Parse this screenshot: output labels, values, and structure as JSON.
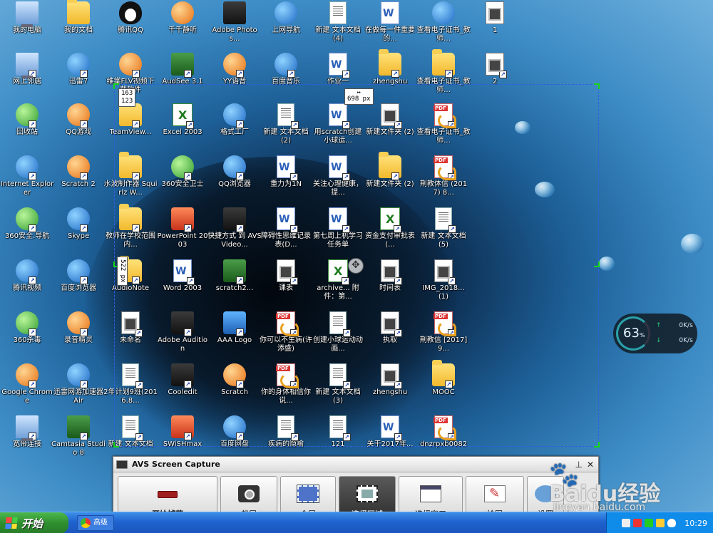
{
  "desktop_icons": [
    {
      "label": "我的电脑",
      "type": "computer"
    },
    {
      "label": "我的文档",
      "type": "folder"
    },
    {
      "label": "腾讯QQ",
      "type": "penguin"
    },
    {
      "label": "千千静听",
      "type": "round-orange"
    },
    {
      "label": "Adobe Photos...",
      "type": "square-dark"
    },
    {
      "label": "上网导航",
      "type": "round-blue"
    },
    {
      "label": "新建 文本文档 (4)",
      "type": "doc"
    },
    {
      "label": "在做每一件重要的...",
      "type": "word"
    },
    {
      "label": "查看电子证书_教师...",
      "type": "round-blue"
    },
    {
      "label": "1",
      "type": "img"
    },
    {
      "label": "网上邻居",
      "type": "computer"
    },
    {
      "label": "迅雷7",
      "type": "round-blue"
    },
    {
      "label": "维棠FLV视频下载软件",
      "type": "round-orange"
    },
    {
      "label": "AudSee 3.1",
      "type": "square-green"
    },
    {
      "label": "YY语音",
      "type": "round-orange"
    },
    {
      "label": "百度音乐",
      "type": "round-blue"
    },
    {
      "label": "作业一",
      "type": "word"
    },
    {
      "label": "zhengshu",
      "type": "folder"
    },
    {
      "label": "查看电子证书_教师...",
      "type": "folder"
    },
    {
      "label": "2",
      "type": "img"
    },
    {
      "label": "回收站",
      "type": "round-green"
    },
    {
      "label": "QQ游戏",
      "type": "round-orange"
    },
    {
      "label": "TeamView...",
      "type": "folder"
    },
    {
      "label": "Excel 2003",
      "type": "excel"
    },
    {
      "label": "格式工厂",
      "type": "round-blue"
    },
    {
      "label": "新建 文本文档 (2)",
      "type": "doc"
    },
    {
      "label": "用scratch创建小球运...",
      "type": "word"
    },
    {
      "label": "新建文件夹 (2)",
      "type": "img"
    },
    {
      "label": "查看电子证书_教师...",
      "type": "pdf"
    },
    {
      "label": "Internet Explorer",
      "type": "round-blue"
    },
    {
      "label": "Scratch 2",
      "type": "round-orange"
    },
    {
      "label": "水波制作器 Squirlz W...",
      "type": "folder"
    },
    {
      "label": "360安全卫士",
      "type": "round-green"
    },
    {
      "label": "QQ浏览器",
      "type": "round-blue"
    },
    {
      "label": "重力为1N",
      "type": "word"
    },
    {
      "label": "关注心理健康，提...",
      "type": "word"
    },
    {
      "label": "新建文件夹 (2)",
      "type": "folder"
    },
    {
      "label": "荆教体信 (2017) 8...",
      "type": "pdf"
    },
    {
      "label": "360安全.导航",
      "type": "round-green"
    },
    {
      "label": "Skype",
      "type": "round-blue"
    },
    {
      "label": "教师在学校范围内...",
      "type": "folder"
    },
    {
      "label": "PowerPoint 2003",
      "type": "square-red"
    },
    {
      "label": "快捷方式 到 AVSVideo...",
      "type": "square-dark"
    },
    {
      "label": "障碍性思维记录表(D...",
      "type": "word"
    },
    {
      "label": "第七周上机学习任务单",
      "type": "word"
    },
    {
      "label": "资金支付审批表(...",
      "type": "excel"
    },
    {
      "label": "新建 文本文档 (5)",
      "type": "doc"
    },
    {
      "label": "腾讯视频",
      "type": "round-blue"
    },
    {
      "label": "百度浏览器",
      "type": "round-blue"
    },
    {
      "label": "AudioNote",
      "type": "folder"
    },
    {
      "label": "Word 2003",
      "type": "word"
    },
    {
      "label": "scratch2...",
      "type": "square-green"
    },
    {
      "label": "课表",
      "type": "img"
    },
    {
      "label": "archive... 附件：第...",
      "type": "excel"
    },
    {
      "label": "时间表",
      "type": "img"
    },
    {
      "label": "IMG_2018... (1)",
      "type": "img"
    },
    {
      "label": "360杀毒",
      "type": "round-green"
    },
    {
      "label": "录音精灵",
      "type": "round-orange"
    },
    {
      "label": "未命名",
      "type": "img"
    },
    {
      "label": "Adobe Audition",
      "type": "square-dark"
    },
    {
      "label": "AAA Logo",
      "type": "square-blue"
    },
    {
      "label": "你可以不生病(许添盛)",
      "type": "pdf"
    },
    {
      "label": "创建小球运动动画...",
      "type": "doc"
    },
    {
      "label": "执取",
      "type": "img"
    },
    {
      "label": "荆教信 [2017]9...",
      "type": "pdf"
    },
    {
      "label": "Google Chrome",
      "type": "round-orange"
    },
    {
      "label": "迅雷网游加速器Air",
      "type": "round-blue"
    },
    {
      "label": "2年计划9班(2016.8...",
      "type": "doc"
    },
    {
      "label": "Cooledit",
      "type": "square-dark"
    },
    {
      "label": "Scratch",
      "type": "round-orange"
    },
    {
      "label": "你的身体相信你说...",
      "type": "pdf"
    },
    {
      "label": "新建 文本文档 (3)",
      "type": "doc"
    },
    {
      "label": "zhengshu",
      "type": "img"
    },
    {
      "label": "MOOC",
      "type": "folder"
    },
    {
      "label": "宽带连接",
      "type": "computer"
    },
    {
      "label": "Camtasia Studio 8",
      "type": "square-green"
    },
    {
      "label": "新建 文本文档",
      "type": "doc"
    },
    {
      "label": "SWiSHmax",
      "type": "square-red"
    },
    {
      "label": "百度网盘",
      "type": "round-blue"
    },
    {
      "label": "疾病的隐喻",
      "type": "doc"
    },
    {
      "label": "121",
      "type": "doc"
    },
    {
      "label": "关于2017年...",
      "type": "word"
    },
    {
      "label": "dnzrpxb0082",
      "type": "pdf"
    }
  ],
  "selection": {
    "origin_readout": [
      "163",
      "123"
    ],
    "width_readout": "698 px",
    "height_readout": "522 px"
  },
  "widget": {
    "cpu_percent": "63",
    "percent_sign": "%",
    "upload": "0K/s",
    "download": "0K/s"
  },
  "avs": {
    "title": "AVS Screen Capture",
    "pin": "⊥",
    "close": "✕",
    "buttons": [
      {
        "label": "开始捕获",
        "icon": "rec",
        "active": false
      },
      {
        "label": "截屏",
        "icon": "cam",
        "active": false
      },
      {
        "label": "全屏",
        "icon": "full",
        "active": false
      },
      {
        "label": "选择区域",
        "icon": "region",
        "active": true
      },
      {
        "label": "选择窗口",
        "icon": "window",
        "active": false
      },
      {
        "label": "绘图",
        "icon": "draw",
        "active": false
      },
      {
        "label": "设置",
        "icon": "settings",
        "active": false
      }
    ]
  },
  "taskbar": {
    "start_label": "开始",
    "task_label": "高级",
    "clock": "10:29"
  },
  "watermark": {
    "paw": "🐾",
    "brand": "Baidu经验",
    "url": "jingyan.baidu.com"
  }
}
